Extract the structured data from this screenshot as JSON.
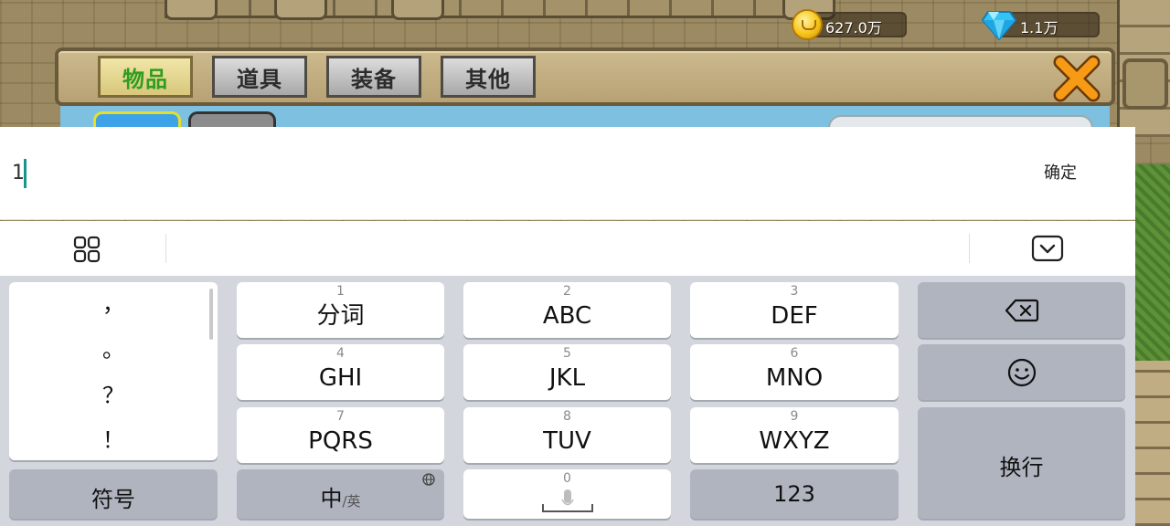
{
  "game": {
    "gold_amount": "627.0万",
    "gem_amount": "1.1万",
    "tabs": [
      {
        "label": "物品",
        "active": true
      },
      {
        "label": "道具",
        "active": false
      },
      {
        "label": "装备",
        "active": false
      },
      {
        "label": "其他",
        "active": false
      }
    ],
    "icons": {
      "gold": "gold-coin-icon",
      "gem": "diamond-icon",
      "close": "close-x-icon"
    }
  },
  "input": {
    "value": "1",
    "confirm_label": "确定"
  },
  "toolbar": {
    "menu_icon": "grid-icon",
    "collapse_icon": "keyboard-collapse-icon"
  },
  "keyboard": {
    "punctuation": [
      "，",
      "。",
      "？",
      "！"
    ],
    "keys": {
      "k1": {
        "num": "1",
        "label": "分词"
      },
      "k2": {
        "num": "2",
        "label": "ABC"
      },
      "k3": {
        "num": "3",
        "label": "DEF"
      },
      "k4": {
        "num": "4",
        "label": "GHI"
      },
      "k5": {
        "num": "5",
        "label": "JKL"
      },
      "k6": {
        "num": "6",
        "label": "MNO"
      },
      "k7": {
        "num": "7",
        "label": "PQRS"
      },
      "k8": {
        "num": "8",
        "label": "TUV"
      },
      "k9": {
        "num": "9",
        "label": "WXYZ"
      },
      "k0": {
        "num": "0"
      }
    },
    "symbols_label": "符号",
    "lang_main": "中",
    "lang_sub": "/英",
    "numbers_label": "123",
    "enter_label": "换行",
    "icons": {
      "backspace": "backspace-icon",
      "emoji": "emoji-icon",
      "globe": "globe-icon",
      "mic": "microphone-icon"
    }
  },
  "colors": {
    "caret": "#17968e",
    "active_tab_text": "#2e9d1e",
    "keyboard_bg": "#d3d6dd"
  }
}
